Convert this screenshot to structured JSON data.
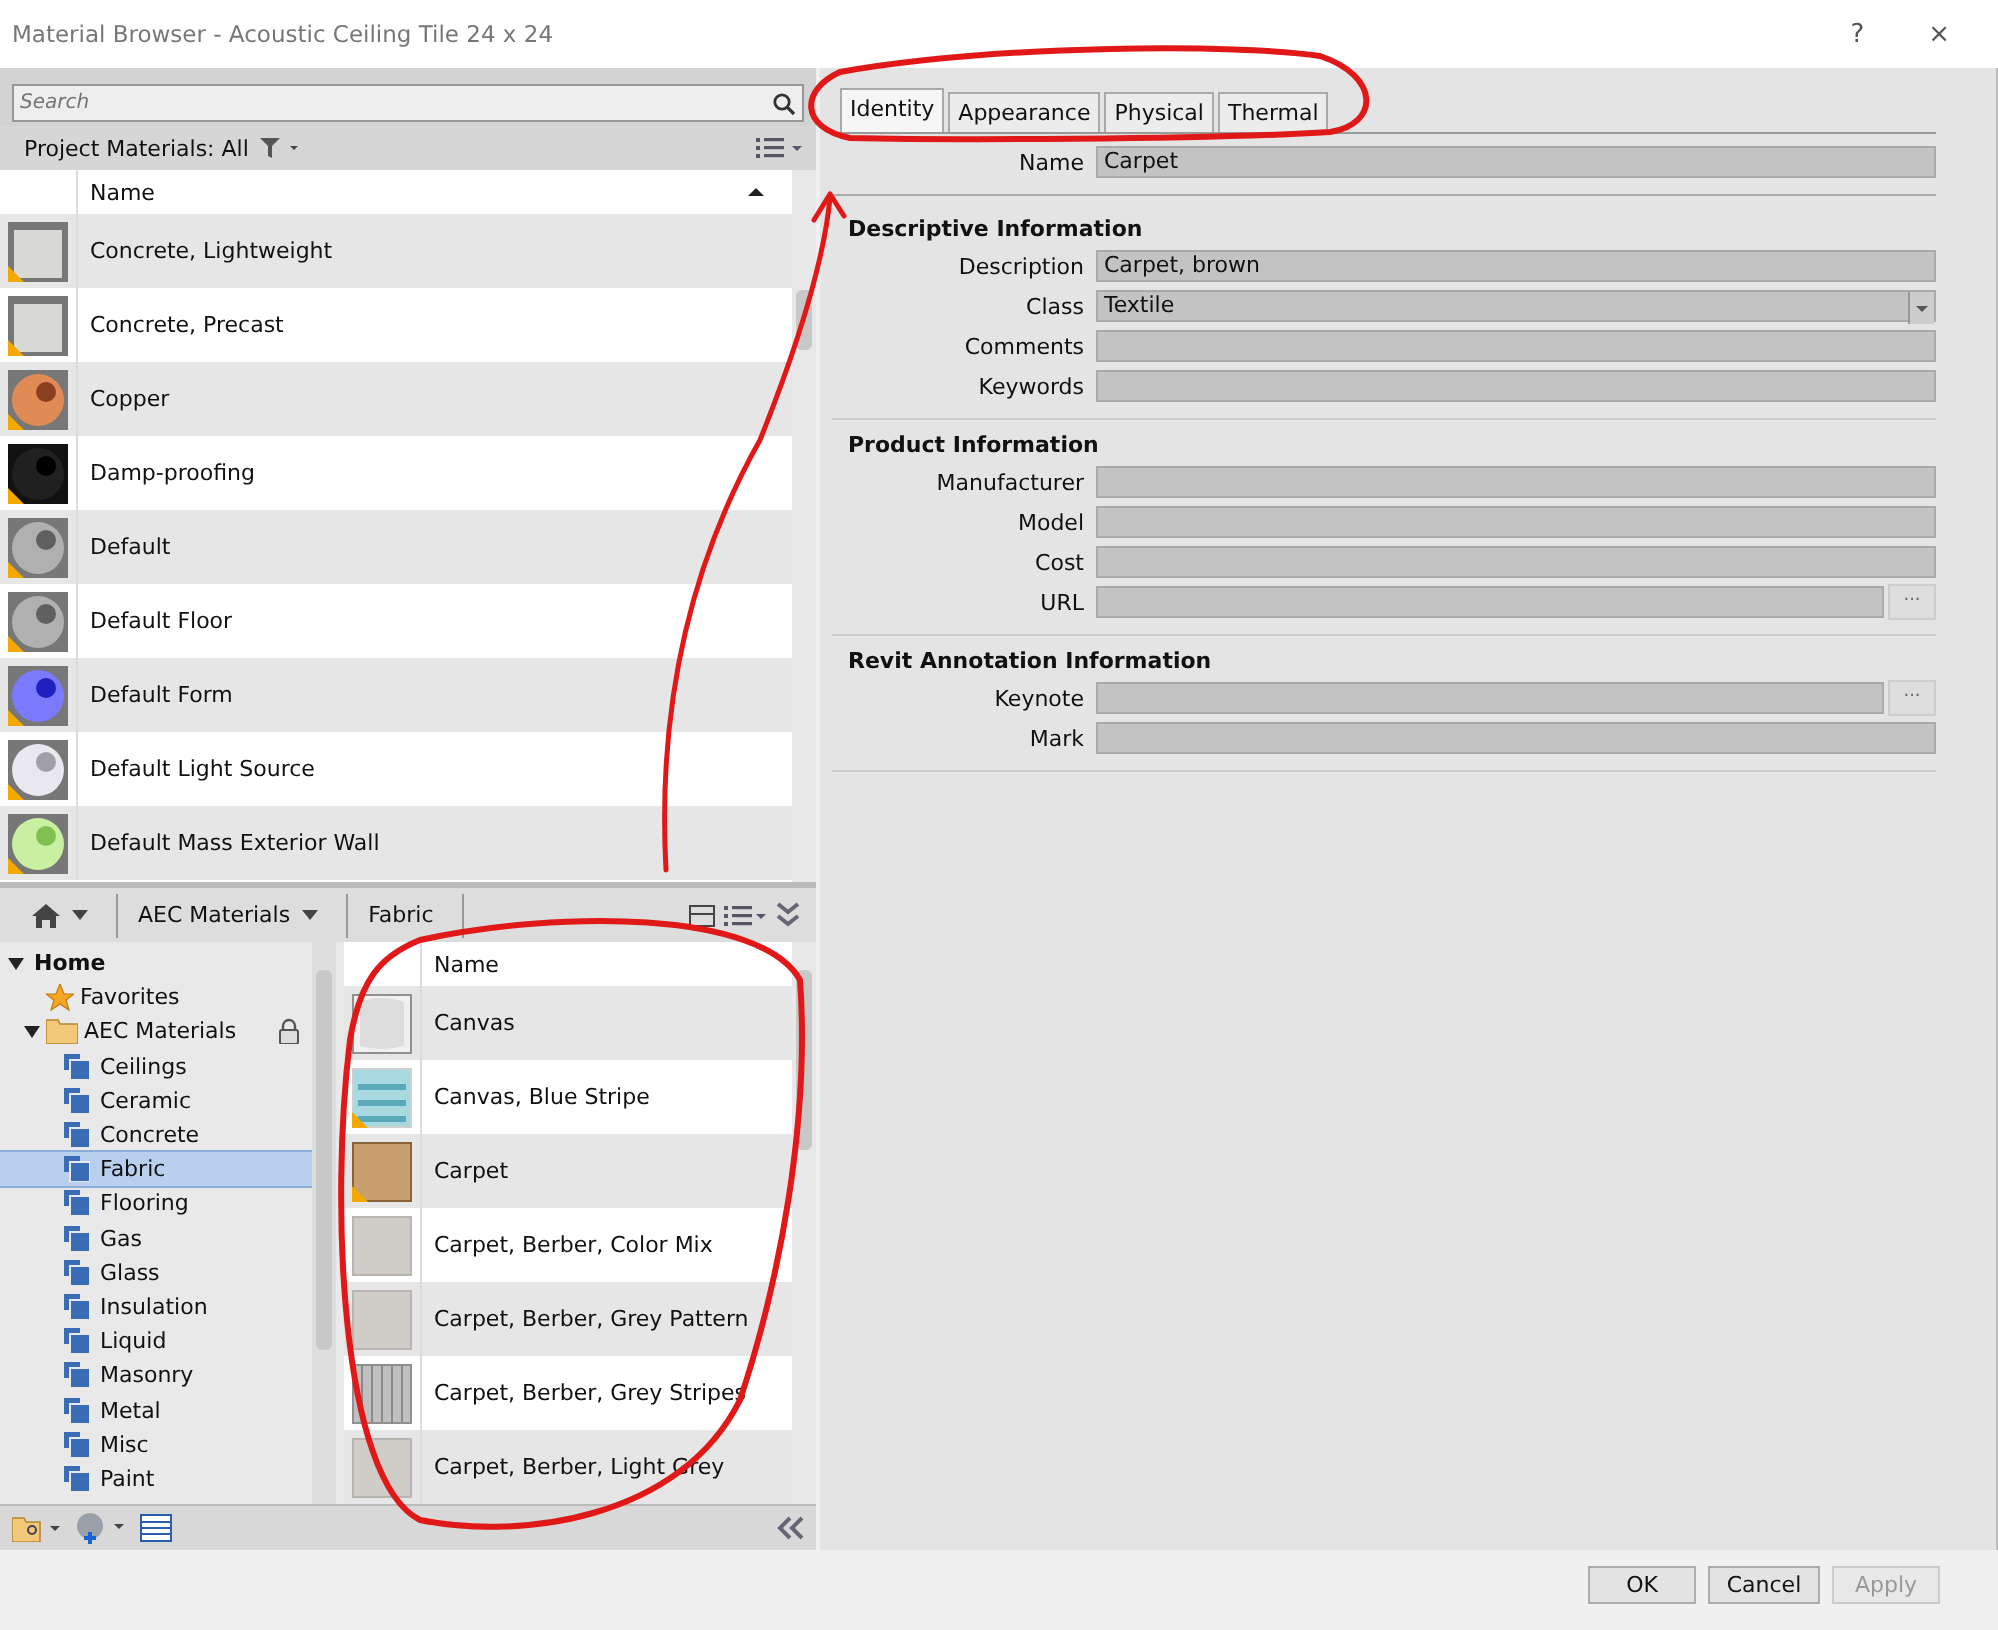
{
  "window": {
    "title": "Material Browser - Acoustic Ceiling Tile 24 x 24",
    "help": "?",
    "close": "×"
  },
  "search": {
    "placeholder": "Search"
  },
  "project_materials": {
    "label": "Project Materials: All",
    "column": "Name",
    "rows": [
      {
        "name": "Concrete, Lightweight",
        "kind": "cube"
      },
      {
        "name": "Concrete, Precast",
        "kind": "cube"
      },
      {
        "name": "Copper",
        "kind": "copper"
      },
      {
        "name": "Damp-proofing",
        "kind": "dark"
      },
      {
        "name": "Default",
        "kind": "grey"
      },
      {
        "name": "Default Floor",
        "kind": "grey"
      },
      {
        "name": "Default Form",
        "kind": "blue"
      },
      {
        "name": "Default Light Source",
        "kind": "light"
      },
      {
        "name": "Default Mass Exterior Wall",
        "kind": "green"
      }
    ]
  },
  "library": {
    "breadcrumb": [
      "AEC Materials",
      "Fabric"
    ],
    "tree": [
      {
        "label": "Home",
        "kind": "root",
        "expanded": true,
        "selected": false,
        "children": [
          {
            "label": "Favorites",
            "kind": "favorites",
            "selected": false
          },
          {
            "label": "AEC Materials",
            "kind": "folder",
            "expanded": true,
            "locked": true,
            "selected": false,
            "children": [
              {
                "label": "Ceilings",
                "kind": "category",
                "selected": false
              },
              {
                "label": "Ceramic",
                "kind": "category",
                "selected": false
              },
              {
                "label": "Concrete",
                "kind": "category",
                "selected": false
              },
              {
                "label": "Fabric",
                "kind": "category",
                "selected": true
              },
              {
                "label": "Flooring",
                "kind": "category",
                "selected": false
              },
              {
                "label": "Gas",
                "kind": "category",
                "selected": false
              },
              {
                "label": "Glass",
                "kind": "category",
                "selected": false
              },
              {
                "label": "Insulation",
                "kind": "category",
                "selected": false
              },
              {
                "label": "Liquid",
                "kind": "category",
                "selected": false
              },
              {
                "label": "Masonry",
                "kind": "category",
                "selected": false
              },
              {
                "label": "Metal",
                "kind": "category",
                "selected": false
              },
              {
                "label": "Misc",
                "kind": "category",
                "selected": false
              },
              {
                "label": "Paint",
                "kind": "category",
                "selected": false
              }
            ]
          }
        ]
      }
    ],
    "column": "Name",
    "rows": [
      {
        "name": "Canvas",
        "kind": "drape"
      },
      {
        "name": "Canvas, Blue Stripe",
        "kind": "stripe"
      },
      {
        "name": "Carpet",
        "kind": "carpet"
      },
      {
        "name": "Carpet, Berber, Color Mix",
        "kind": "flat"
      },
      {
        "name": "Carpet, Berber, Grey Pattern",
        "kind": "flat"
      },
      {
        "name": "Carpet, Berber, Grey Stripes",
        "kind": "lines"
      },
      {
        "name": "Carpet, Berber, Light Grey",
        "kind": "flat"
      }
    ]
  },
  "tabs": [
    {
      "label": "Identity",
      "selected": true
    },
    {
      "label": "Appearance",
      "selected": false
    },
    {
      "label": "Physical",
      "selected": false
    },
    {
      "label": "Thermal",
      "selected": false
    }
  ],
  "name_field": {
    "label": "Name",
    "value": "Carpet"
  },
  "sections": [
    {
      "title": "Descriptive Information",
      "fields": [
        {
          "label": "Description",
          "value": "Carpet, brown",
          "kind": "text"
        },
        {
          "label": "Class",
          "value": "Textile",
          "kind": "dropdown"
        },
        {
          "label": "Comments",
          "kind": "text"
        },
        {
          "label": "Keywords",
          "kind": "text"
        }
      ]
    },
    {
      "title": "Product Information",
      "fields": [
        {
          "label": "Manufacturer",
          "kind": "text"
        },
        {
          "label": "Model",
          "kind": "text"
        },
        {
          "label": "Cost",
          "kind": "text"
        },
        {
          "label": "URL",
          "kind": "browse",
          "browse": "..."
        }
      ]
    },
    {
      "title": "Revit Annotation Information",
      "fields": [
        {
          "label": "Keynote",
          "kind": "browse",
          "browse": "..."
        },
        {
          "label": "Mark",
          "kind": "text"
        }
      ]
    }
  ],
  "buttons": [
    {
      "label": "OK",
      "disabled": false
    },
    {
      "label": "Cancel",
      "disabled": false
    },
    {
      "label": "Apply",
      "disabled": true
    }
  ],
  "annotations": [
    {
      "kind": "circle"
    },
    {
      "kind": "circle"
    },
    {
      "kind": "arrow"
    }
  ]
}
